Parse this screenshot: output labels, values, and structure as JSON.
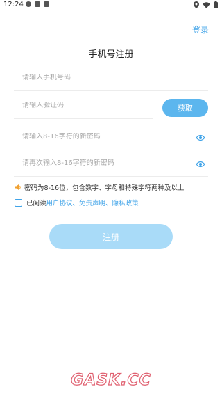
{
  "status_bar": {
    "time": "12:24"
  },
  "header": {
    "login_label": "登录",
    "title": "手机号注册"
  },
  "form": {
    "phone_placeholder": "请输入手机号码",
    "code_placeholder": "请输入验证码",
    "get_code_label": "获取",
    "password_placeholder": "请输入8-16字符的新密码",
    "confirm_password_placeholder": "请再次输入8-16字符的新密码"
  },
  "tip": {
    "text": "密码为8-16位，包含数字、字母和特殊字符两种及以上"
  },
  "agreement": {
    "prefix": "已阅读",
    "user_agreement": "用户协议",
    "sep1": "、",
    "disclaimer": "免责声明",
    "sep2": "、",
    "privacy_policy": "隐私政策",
    "checked": false
  },
  "register_label": "注册",
  "watermark": "GASK.CC",
  "colors": {
    "accent": "#3fa3e8",
    "button_active": "#5cb6ee",
    "button_disabled": "#a9dbf8"
  }
}
